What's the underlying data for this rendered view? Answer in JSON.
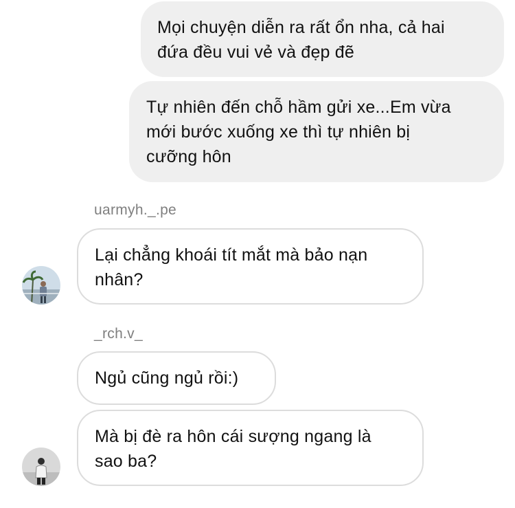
{
  "messages": [
    {
      "direction": "outgoing",
      "text": "Mọi chuyện diễn ra rất ổn nha, cả hai\nđứa đều vui vẻ và đẹp đẽ"
    },
    {
      "direction": "outgoing",
      "text": "Tự nhiên đến chỗ hầm gửi xe...Em vừa\nmới bước xuống xe thì tự nhiên bị\ncưỡng hôn"
    },
    {
      "direction": "incoming",
      "sender": "uarmyh._.pe",
      "text": "Lại chẳng khoái tít mắt mà bảo nạn\nnhân?"
    },
    {
      "direction": "incoming",
      "sender": "_rch.v_",
      "text": "Ngủ cũng ngủ rồi:)"
    },
    {
      "direction": "incoming",
      "sender": "_rch.v_",
      "text": "Mà bị đè ra hôn cái sượng ngang là\nsao ba?"
    }
  ],
  "avatars": [
    {
      "user": "uarmyh._.pe",
      "icon": "profile-photo-palm-trees"
    },
    {
      "user": "_rch.v_",
      "icon": "profile-photo-person"
    }
  ],
  "colors": {
    "outgoing_bubble": "#efefef",
    "incoming_border": "#dcdcdc",
    "sender_text": "#7f7f7f"
  }
}
